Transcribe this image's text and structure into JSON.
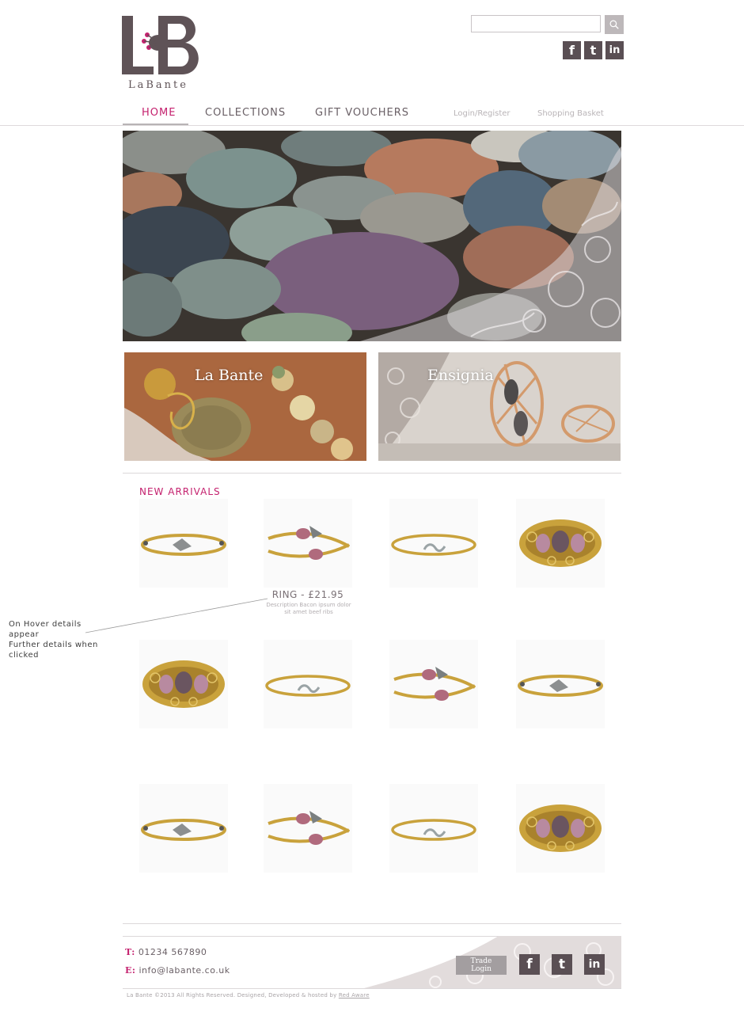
{
  "brand": {
    "name": "LaBante",
    "monogram": "LB"
  },
  "search": {
    "placeholder": "",
    "value": ""
  },
  "social": {
    "facebook": "f",
    "twitter": "t",
    "linkedin": "in"
  },
  "nav": {
    "items": [
      {
        "label": "HOME",
        "active": true
      },
      {
        "label": "COLLECTIONS",
        "active": false
      },
      {
        "label": "GIFT VOUCHERS",
        "active": false
      }
    ],
    "login": "Login/Register",
    "basket": "Shopping Basket"
  },
  "promos": [
    {
      "title": "La Bante"
    },
    {
      "title": "Ensignia"
    }
  ],
  "new_arrivals": {
    "title": "NEW ARRIVALS",
    "hover_product": {
      "title": "RING - £21.95",
      "description": "Description Bacon ipsum dolor sit amet beef ribs"
    },
    "products": [
      {
        "icon": "thin-bangle-crystal-icon"
      },
      {
        "icon": "wrap-bangle-pink-icon"
      },
      {
        "icon": "thin-bangle-icon"
      },
      {
        "icon": "filigree-cuff-icon"
      },
      {
        "icon": "filigree-cuff-icon"
      },
      {
        "icon": "thin-bangle-icon"
      },
      {
        "icon": "wrap-bangle-pink-icon"
      },
      {
        "icon": "thin-bangle-crystal-icon"
      },
      {
        "icon": "thin-bangle-crystal-icon"
      },
      {
        "icon": "wrap-bangle-pink-icon"
      },
      {
        "icon": "thin-bangle-icon"
      },
      {
        "icon": "filigree-cuff-icon"
      }
    ]
  },
  "annotation": {
    "lines": [
      "On Hover details",
      "appear",
      "Further details when",
      "clicked"
    ]
  },
  "footer": {
    "phone_label": "T:",
    "phone": "01234 567890",
    "email_label": "E:",
    "email": "info@labante.co.uk",
    "trade_login": "Trade Login",
    "copyright": "La Bante ©2013 All Rights Reserved. Designed, Developed & hosted by ",
    "credit": "Red Aware"
  },
  "colors": {
    "accent": "#c4216e",
    "brand_dark": "#5a4f54",
    "rule": "#dcd8da"
  }
}
